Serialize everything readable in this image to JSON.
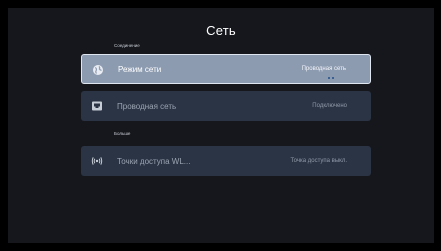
{
  "screen": {
    "title": "Сеть",
    "sections": [
      {
        "label": "Соединение"
      },
      {
        "label": "Больше"
      }
    ],
    "rows": [
      {
        "label": "Режим сети",
        "value": "Проводная сеть",
        "icon": "globe-icon"
      },
      {
        "label": "Проводная сеть",
        "value": "Подключено",
        "icon": "ethernet-icon"
      },
      {
        "label": "Точки доступа WL...",
        "value": "Точка доступа выкл.",
        "icon": "wireless-hotspot-icon"
      }
    ]
  },
  "colors": {
    "background": "#15171c",
    "selected_row": "#8d9bb0",
    "row": "#2b3444",
    "text": "#ffffff"
  }
}
